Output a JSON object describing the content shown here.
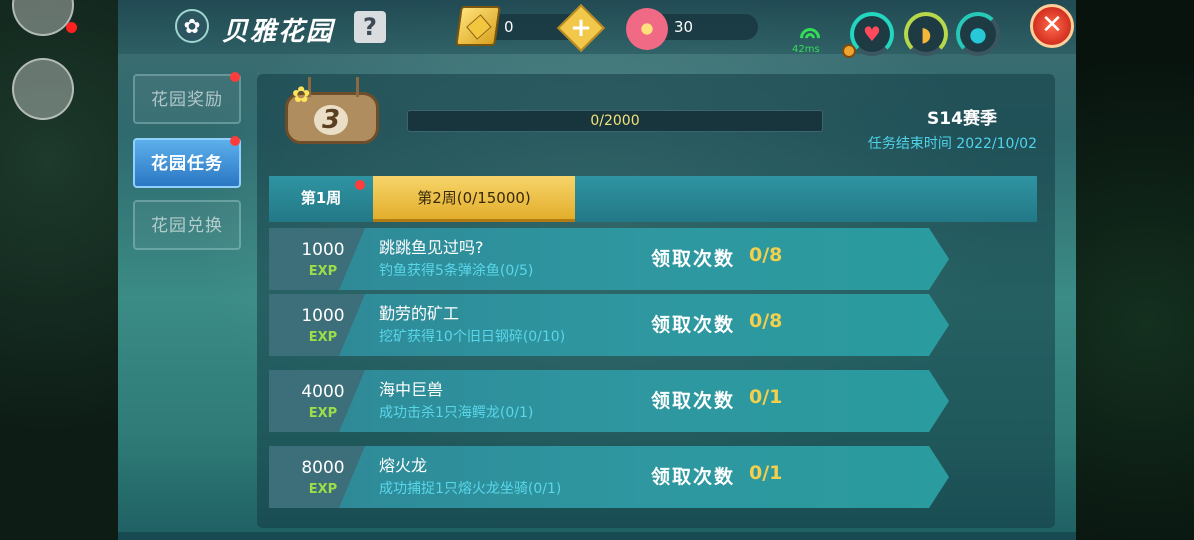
{
  "window": {
    "title": "贝雅花园",
    "help_label": "?",
    "close_label": "✕"
  },
  "currencies": {
    "diamond": {
      "value": "0",
      "icon": "diamond-icon",
      "plus_label": "+"
    },
    "flower": {
      "value": "30",
      "icon": "flower-icon"
    }
  },
  "status": {
    "ping": "42ms",
    "icons": [
      "signal-icon",
      "heart-icon",
      "food-icon",
      "water-drop-icon"
    ]
  },
  "sidebar": {
    "items": [
      {
        "label": "花园奖励",
        "active": false,
        "has_dot": true
      },
      {
        "label": "花园任务",
        "active": true,
        "has_dot": true
      },
      {
        "label": "花园兑换",
        "active": false,
        "has_dot": false
      }
    ]
  },
  "level": {
    "value": "3",
    "progress_text": "0/2000",
    "progress_fraction": 0
  },
  "season": {
    "title": "S14赛季",
    "end_label": "任务结束时间 2022/10/02"
  },
  "weeks": [
    {
      "label": "第1周",
      "active": false,
      "has_dot": true
    },
    {
      "label": "第2周(0/15000)",
      "active": true,
      "has_dot": false
    }
  ],
  "tasks": [
    {
      "exp": "1000",
      "exp_unit": "EXP",
      "name": "跳跳鱼见过吗?",
      "desc": "钓鱼获得5条弹涂鱼(0/5)",
      "claim_label": "领取次数",
      "claim_count": "0/8"
    },
    {
      "exp": "1000",
      "exp_unit": "EXP",
      "name": "勤劳的矿工",
      "desc": "挖矿获得10个旧日钢碎(0/10)",
      "claim_label": "领取次数",
      "claim_count": "0/8"
    },
    {
      "exp": "4000",
      "exp_unit": "EXP",
      "name": "海中巨兽",
      "desc": "成功击杀1只海鳄龙(0/1)",
      "claim_label": "领取次数",
      "claim_count": "0/1"
    },
    {
      "exp": "8000",
      "exp_unit": "EXP",
      "name": "熔火龙",
      "desc": "成功捕捉1只熔火龙坐骑(0/1)",
      "claim_label": "领取次数",
      "claim_count": "0/1"
    }
  ],
  "colors": {
    "accent": "#f2d04d",
    "active_tab": "#2b77c4",
    "exp": "#9ddd4a",
    "desc": "#5ad6ea",
    "close": "#d22f20"
  }
}
